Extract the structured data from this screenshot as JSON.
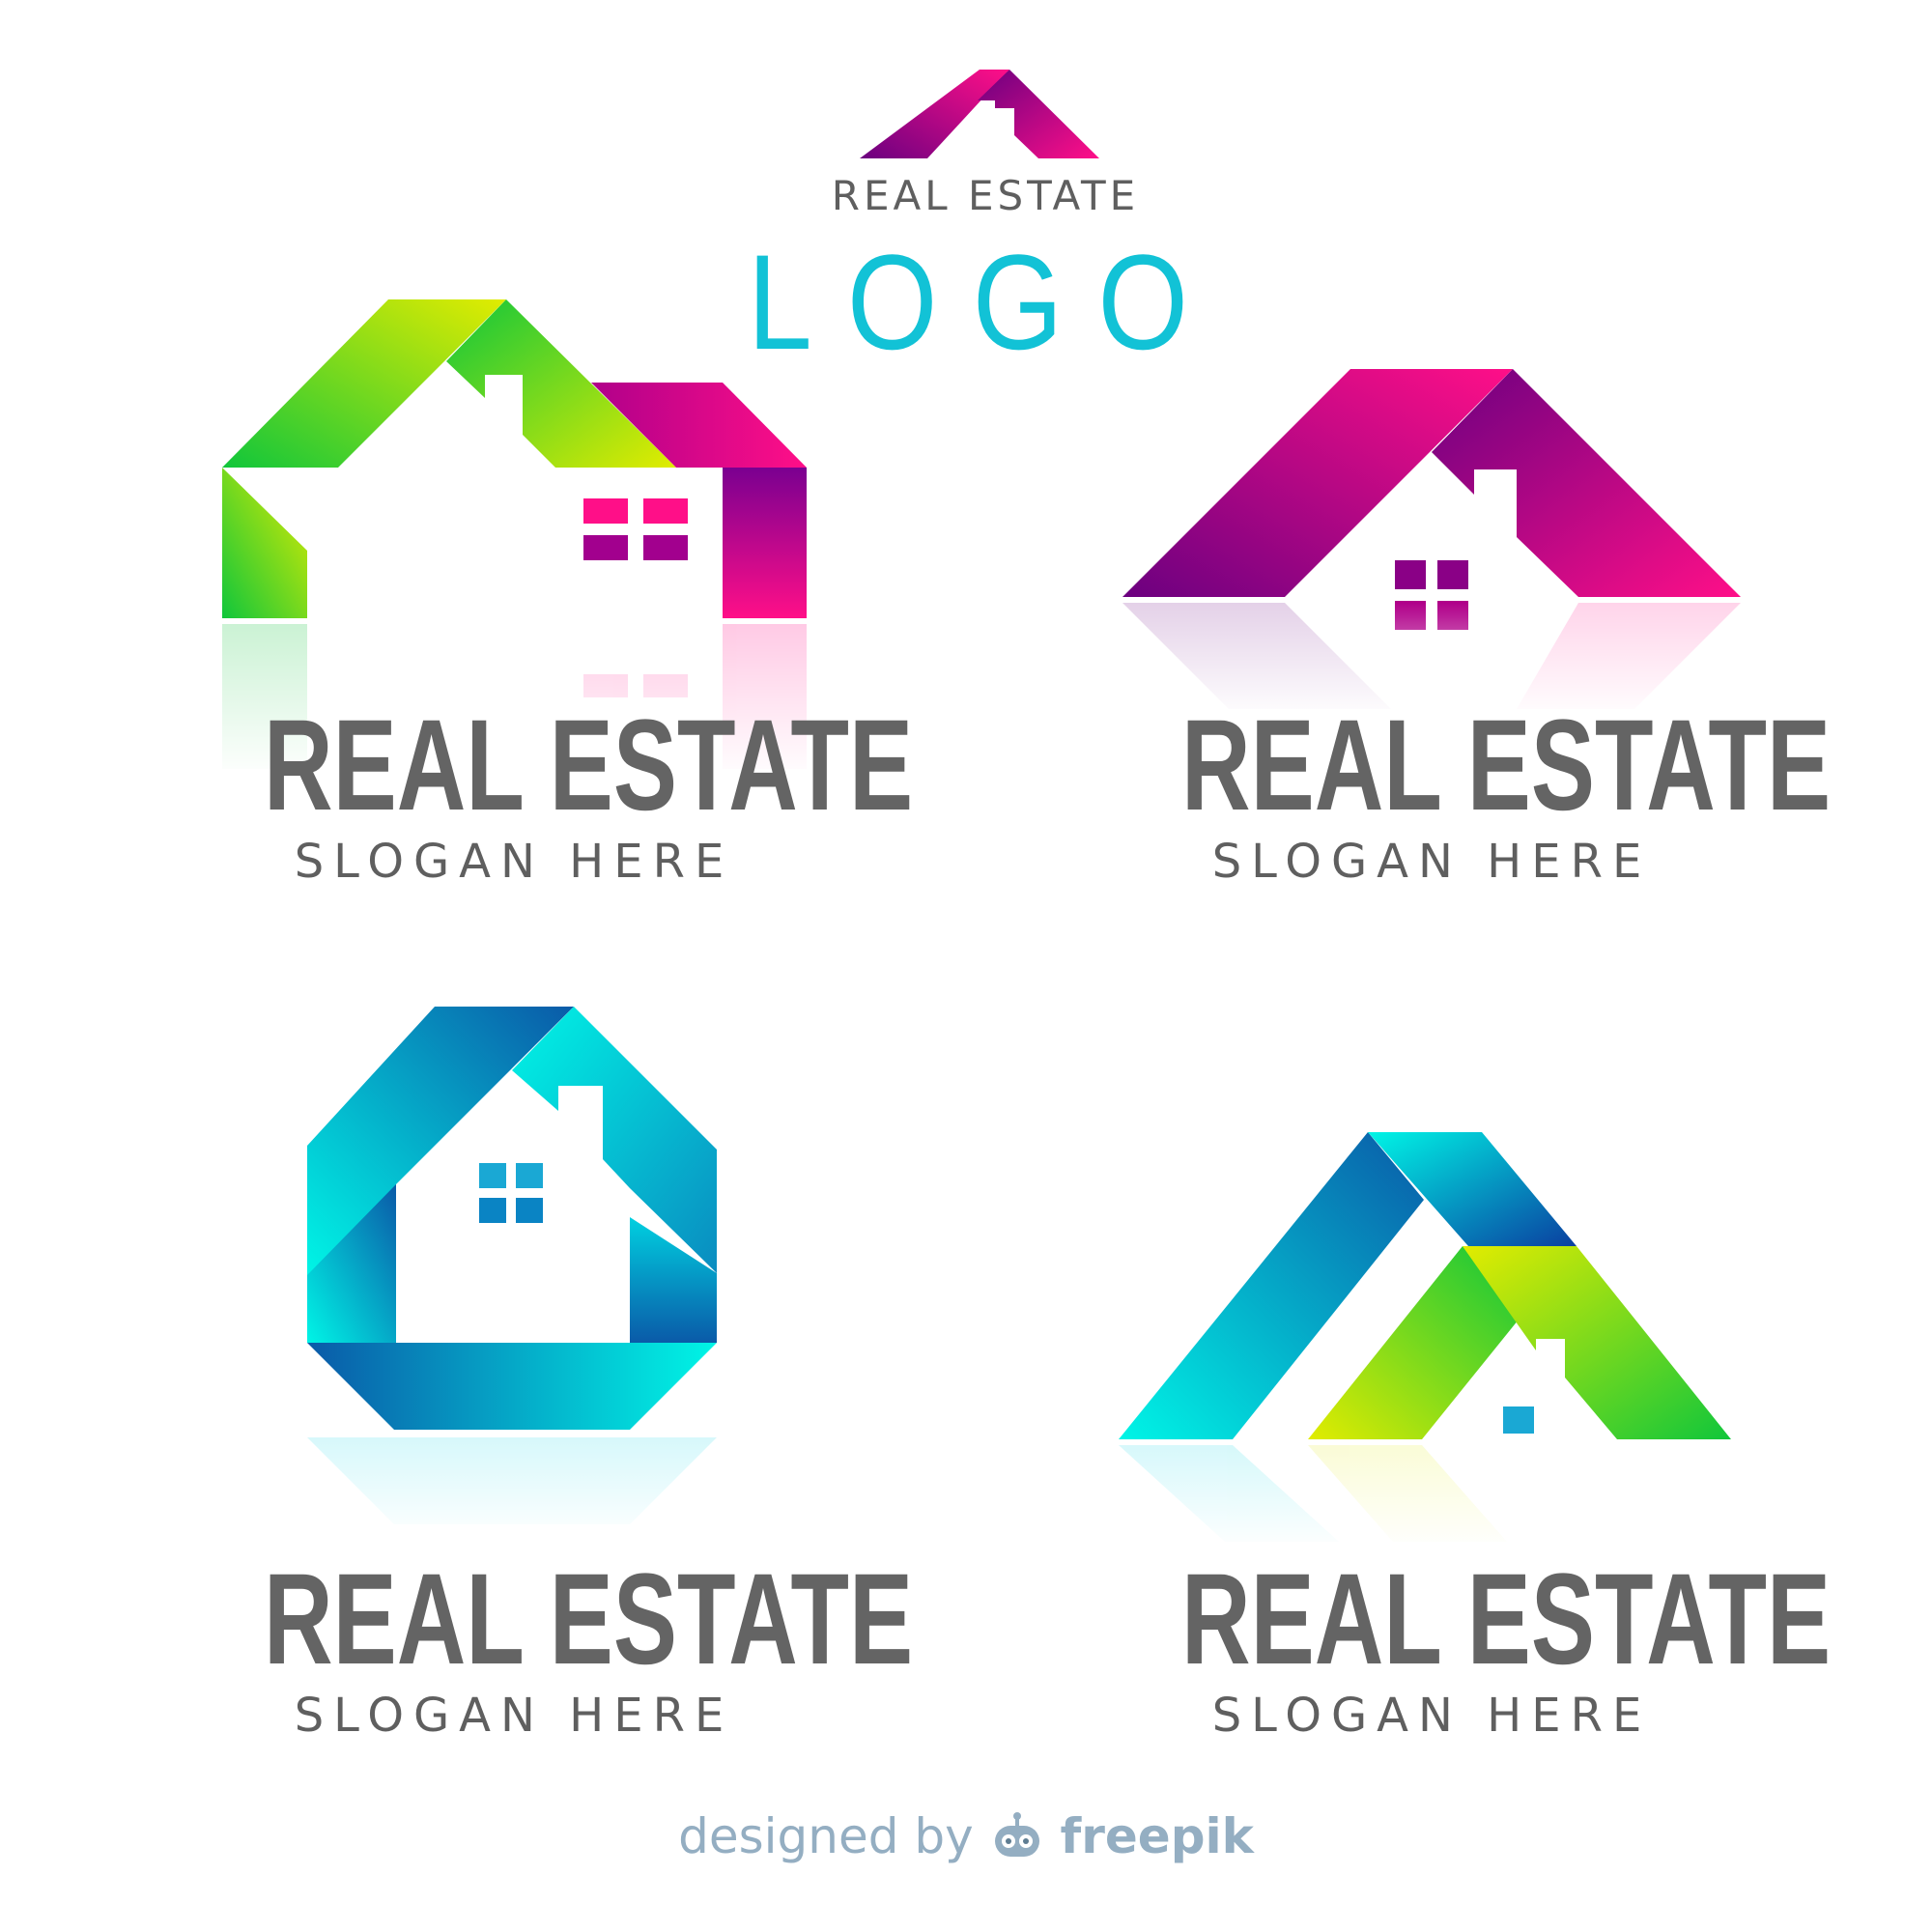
{
  "header": {
    "subtitle": "REAL ESTATE",
    "title": "LOGO"
  },
  "logos": [
    {
      "title": "REAL ESTATE",
      "slogan": "SLOGAN HERE",
      "palette": [
        "#10c63b",
        "#e2ec00",
        "#ff0f88",
        "#6b0080"
      ]
    },
    {
      "title": "REAL ESTATE",
      "slogan": "SLOGAN HERE",
      "palette": [
        "#ff0f88",
        "#6b0080"
      ]
    },
    {
      "title": "REAL ESTATE",
      "slogan": "SLOGAN HERE",
      "palette": [
        "#00f5e6",
        "#0a5aa8"
      ]
    },
    {
      "title": "REAL ESTATE",
      "slogan": "SLOGAN HERE",
      "palette": [
        "#00f5e6",
        "#0a5aa8",
        "#e2ec00",
        "#10c63b"
      ]
    }
  ],
  "credit": {
    "prefix": "designed by",
    "brand": "freepik",
    "color": "#94aec2"
  }
}
